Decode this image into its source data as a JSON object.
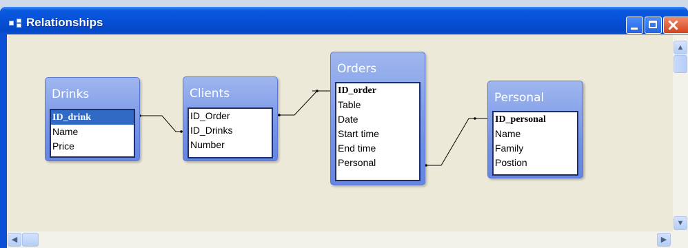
{
  "window": {
    "title": "Relationships",
    "buttons": {
      "minimize": "minimize",
      "maximize": "maximize",
      "close": "close"
    }
  },
  "tables": {
    "drinks": {
      "name": "Drinks",
      "fields": [
        "ID_drink",
        "Name",
        "Price"
      ],
      "primary_key": "ID_drink",
      "selected": "ID_drink"
    },
    "clients": {
      "name": "Clients",
      "fields": [
        "ID_Order",
        "ID_Drinks",
        "Number"
      ]
    },
    "orders": {
      "name": "Orders",
      "fields": [
        "ID_order",
        "Table",
        "Date",
        "Start time",
        "End time",
        "Personal"
      ],
      "primary_key": "ID_order"
    },
    "personal": {
      "name": "Personal",
      "fields": [
        "ID_personal",
        "Name",
        "Family",
        "Postion"
      ],
      "primary_key": "ID_personal"
    }
  },
  "relationships": [
    {
      "from": "Drinks.ID_drink",
      "to": "Clients.ID_Drinks"
    },
    {
      "from": "Clients.ID_Order",
      "to": "Orders.ID_order"
    },
    {
      "from": "Orders.Personal",
      "to": "Personal.ID_personal"
    }
  ],
  "icons": {
    "app": "relationships-icon",
    "scroll_up": "arrow-up-icon",
    "scroll_down": "arrow-down-icon",
    "scroll_left": "arrow-left-icon",
    "scroll_right": "arrow-right-icon"
  }
}
